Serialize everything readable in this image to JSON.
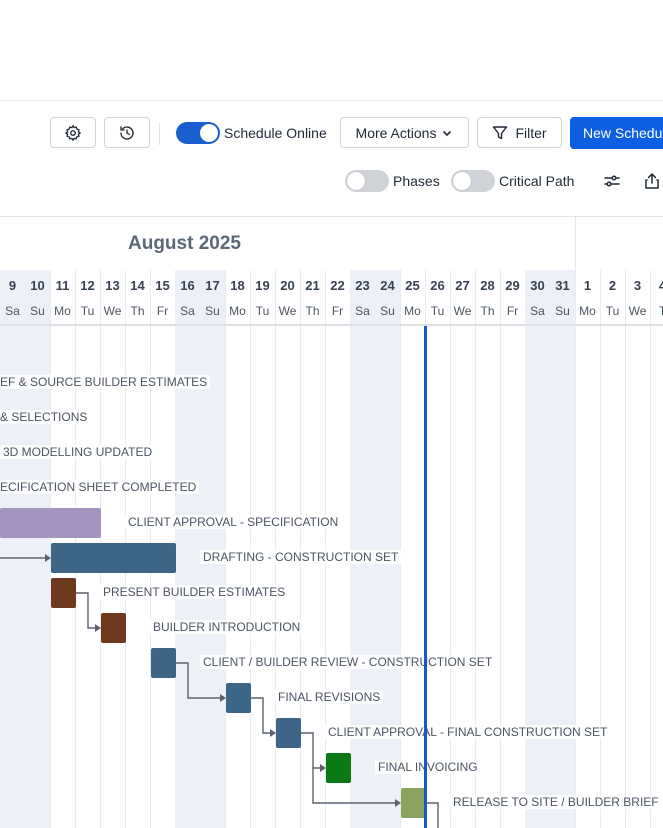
{
  "toolbar": {
    "schedule_online_label": "Schedule Online",
    "schedule_online_on": true,
    "more_actions_label": "More Actions",
    "filter_label": "Filter",
    "new_schedule_label": "New Schedul",
    "phases_label": "Phases",
    "phases_on": false,
    "critical_path_label": "Critical Path",
    "critical_path_on": false
  },
  "calendar": {
    "month_title": "August 2025",
    "days": [
      {
        "num": "9",
        "name": "Sa",
        "weekend": true
      },
      {
        "num": "10",
        "name": "Su",
        "weekend": true
      },
      {
        "num": "11",
        "name": "Mo",
        "weekend": false
      },
      {
        "num": "12",
        "name": "Tu",
        "weekend": false
      },
      {
        "num": "13",
        "name": "We",
        "weekend": false
      },
      {
        "num": "14",
        "name": "Th",
        "weekend": false
      },
      {
        "num": "15",
        "name": "Fr",
        "weekend": false
      },
      {
        "num": "16",
        "name": "Sa",
        "weekend": true
      },
      {
        "num": "17",
        "name": "Su",
        "weekend": true
      },
      {
        "num": "18",
        "name": "Mo",
        "weekend": false
      },
      {
        "num": "19",
        "name": "Tu",
        "weekend": false
      },
      {
        "num": "20",
        "name": "We",
        "weekend": false
      },
      {
        "num": "21",
        "name": "Th",
        "weekend": false
      },
      {
        "num": "22",
        "name": "Fr",
        "weekend": false
      },
      {
        "num": "23",
        "name": "Sa",
        "weekend": true
      },
      {
        "num": "24",
        "name": "Su",
        "weekend": true
      },
      {
        "num": "25",
        "name": "Mo",
        "weekend": false
      },
      {
        "num": "26",
        "name": "Tu",
        "weekend": false
      },
      {
        "num": "27",
        "name": "We",
        "weekend": false
      },
      {
        "num": "28",
        "name": "Th",
        "weekend": false
      },
      {
        "num": "29",
        "name": "Fr",
        "weekend": false
      },
      {
        "num": "30",
        "name": "Sa",
        "weekend": true
      },
      {
        "num": "31",
        "name": "Su",
        "weekend": true
      },
      {
        "num": "1",
        "name": "Mo",
        "weekend": false
      },
      {
        "num": "2",
        "name": "Tu",
        "weekend": false
      },
      {
        "num": "3",
        "name": "We",
        "weekend": false
      },
      {
        "num": "4",
        "name": "T",
        "weekend": false
      }
    ],
    "today_day": "25"
  },
  "tasks": [
    {
      "label": "EF & SOURCE BUILDER ESTIMATES"
    },
    {
      "label": "& SELECTIONS"
    },
    {
      "label": "3D MODELLING UPDATED"
    },
    {
      "label": "ECIFICATION SHEET COMPLETED"
    },
    {
      "label": "CLIENT APPROVAL - SPECIFICATION",
      "color": "#a394c0"
    },
    {
      "label": "DRAFTING - CONSTRUCTION SET",
      "color": "#3d6587"
    },
    {
      "label": "PRESENT BUILDER ESTIMATES",
      "color": "#6e3a1d"
    },
    {
      "label": "BUILDER INTRODUCTION",
      "color": "#6e3a1d"
    },
    {
      "label": "CLIENT / BUILDER REVIEW - CONSTRUCTION SET",
      "color": "#3d6587"
    },
    {
      "label": "FINAL REVISIONS",
      "color": "#3d6587"
    },
    {
      "label": "CLIENT APPROVAL - FINAL CONSTRUCTION SET",
      "color": "#3d6587"
    },
    {
      "label": "FINAL INVOICING",
      "color": "#0a7a12"
    },
    {
      "label": "RELEASE TO SITE / BUILDER BRIEF",
      "color": "#8aa35f"
    }
  ]
}
